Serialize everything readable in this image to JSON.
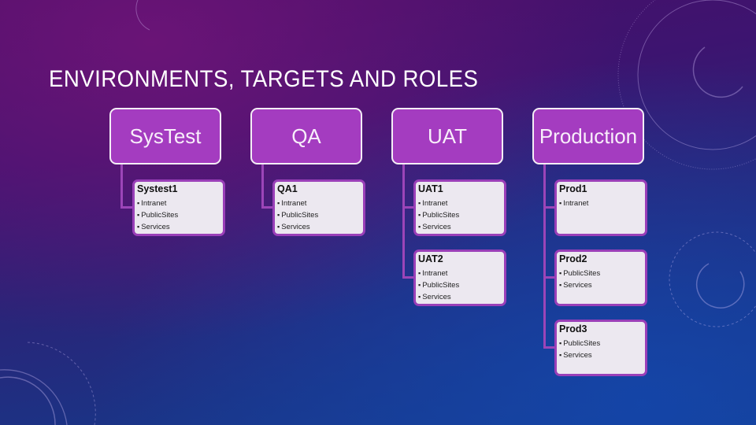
{
  "slide": {
    "title": "ENVIRONMENTS, TARGETS AND ROLES"
  },
  "environments": [
    {
      "label": "SysTest",
      "targets": [
        {
          "name": "Systest1",
          "roles": [
            "Intranet",
            "PublicSites",
            "Services"
          ]
        }
      ]
    },
    {
      "label": "QA",
      "targets": [
        {
          "name": "QA1",
          "roles": [
            "Intranet",
            "PublicSites",
            "Services"
          ]
        }
      ]
    },
    {
      "label": "UAT",
      "targets": [
        {
          "name": "UAT1",
          "roles": [
            "Intranet",
            "PublicSites",
            "Services"
          ]
        },
        {
          "name": "UAT2",
          "roles": [
            "Intranet",
            "PublicSites",
            "Services"
          ]
        }
      ]
    },
    {
      "label": "Production",
      "targets": [
        {
          "name": "Prod1",
          "roles": [
            "Intranet"
          ]
        },
        {
          "name": "Prod2",
          "roles": [
            "PublicSites",
            "Services"
          ]
        },
        {
          "name": "Prod3",
          "roles": [
            "PublicSites",
            "Services"
          ]
        }
      ]
    }
  ],
  "colors": {
    "header_fill": "#a43cc0",
    "card_fill": "#ece8f0",
    "card_border": "#9a3fb8",
    "connector": "#9c45b8"
  }
}
